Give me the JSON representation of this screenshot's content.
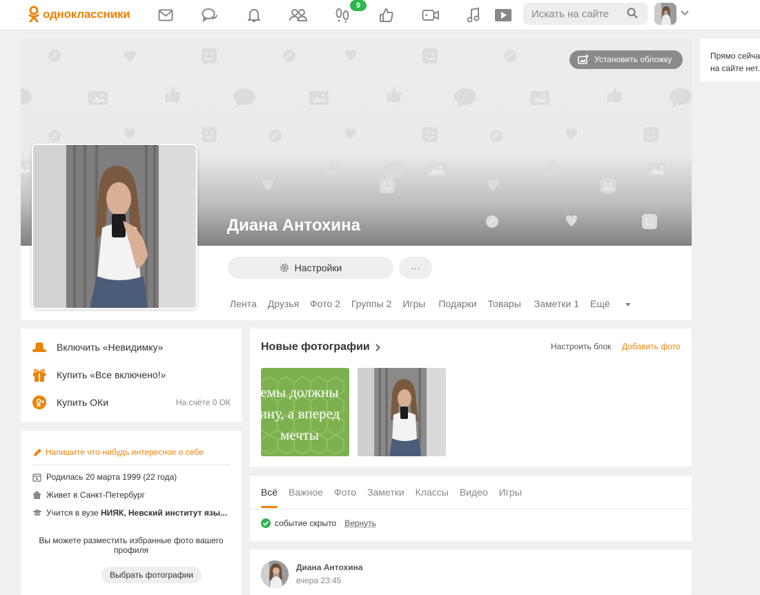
{
  "header": {
    "logo_text": "одноклассники",
    "notification_badge": "9",
    "search_placeholder": "Искать на сайте",
    "nav_icons": [
      "mail-icon",
      "chat-icon",
      "bell-icon",
      "friends-icon",
      "guests-icon",
      "likes-icon",
      "video-icon",
      "music-icon",
      "play-icon"
    ]
  },
  "side_note": {
    "text_line1": "Прямо сейча",
    "text_line2": "на сайте нет."
  },
  "profile": {
    "cover_button": "Установить обложку",
    "name": "Диана Антохина",
    "settings_button": "Настройки",
    "more_button": "···",
    "tabs": [
      "Лента",
      "Друзья",
      "Фото 2",
      "Группы 2",
      "Игры",
      "Подарки",
      "Товары",
      "Заметки 1",
      "Ещё"
    ]
  },
  "services": {
    "items": [
      {
        "label": "Включить «Невидимку»",
        "icon": "hat-icon"
      },
      {
        "label": "Купить «Все включено!»",
        "icon": "gift-icon"
      },
      {
        "label": "Купить ОКи",
        "icon": "ok-coin-icon"
      }
    ],
    "balance": "На счёте 0 ОК"
  },
  "about": {
    "write_prompt": "Напишите что-нибудь интересное о себе",
    "born": "Родилась 20 марта 1999 (22 года)",
    "lives": "Живет в Санкт-Петербург",
    "study_prefix": "Учится в вузе ",
    "study_name": "НИЯК, Невский институт язы...",
    "favorites_text": "Вы можете разместить избранные фото вашего профиля",
    "favorites_button": "Выбрать фотографии"
  },
  "photos": {
    "title": "Новые фотографии",
    "setup": "Настроить блок",
    "add": "Добавить фото",
    "green_text": [
      "емы должны",
      "ину, а вперед",
      "мечты"
    ]
  },
  "feed": {
    "tabs": [
      "Всё",
      "Важное",
      "Фото",
      "Заметки",
      "Классы",
      "Видео",
      "Игры"
    ],
    "hidden_text": "событие скрыто",
    "undo": "Вернуть"
  },
  "post": {
    "author": "Диана Антохина",
    "time": "вчера 23:45"
  },
  "colors": {
    "accent": "#ee8208",
    "success": "#2cb64f"
  }
}
